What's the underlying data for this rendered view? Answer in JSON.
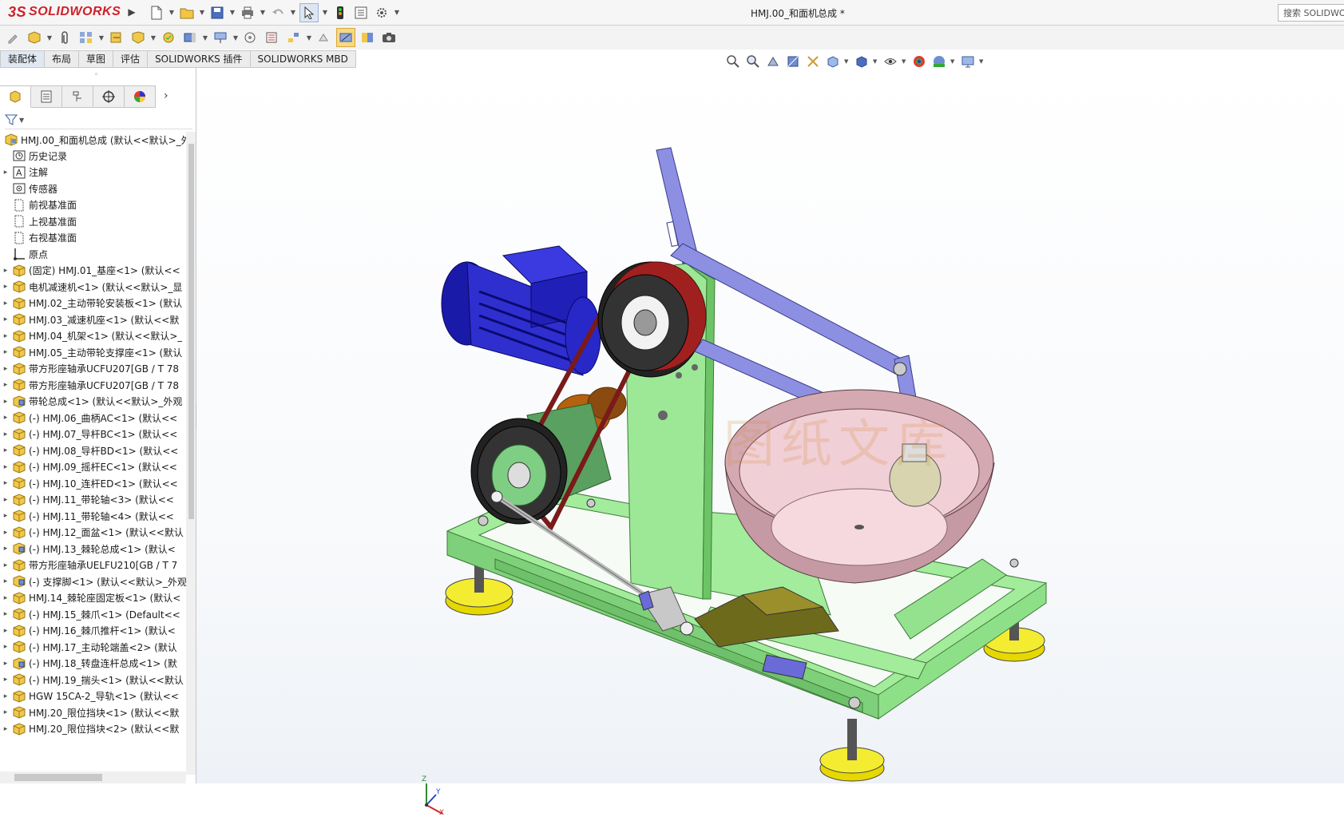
{
  "app": {
    "logo_text": "SOLIDWORKS",
    "logo_prefix": "3S",
    "document_title": "HMJ.00_和面机总成 *",
    "search_placeholder": "搜索 SOLIDWORKS"
  },
  "command_tabs": [
    {
      "label": "装配体",
      "active": true
    },
    {
      "label": "布局"
    },
    {
      "label": "草图"
    },
    {
      "label": "评估"
    },
    {
      "label": "SOLIDWORKS 插件"
    },
    {
      "label": "SOLIDWORKS MBD"
    }
  ],
  "feature_tree": {
    "root": "HMJ.00_和面机总成 (默认<<默认>_外",
    "items": [
      {
        "label": "历史记录",
        "icon": "history-icon",
        "expandable": false
      },
      {
        "label": "注解",
        "icon": "annotation-icon",
        "expandable": true
      },
      {
        "label": "传感器",
        "icon": "sensor-icon",
        "expandable": false
      },
      {
        "label": "前视基准面",
        "icon": "plane-icon",
        "expandable": false
      },
      {
        "label": "上视基准面",
        "icon": "plane-icon",
        "expandable": false
      },
      {
        "label": "右视基准面",
        "icon": "plane-icon",
        "expandable": false
      },
      {
        "label": "原点",
        "icon": "origin-icon",
        "expandable": false
      },
      {
        "label": "(固定) HMJ.01_基座<1> (默认<<",
        "icon": "part-icon",
        "expandable": true
      },
      {
        "label": "电机减速机<1> (默认<<默认>_显",
        "icon": "part-icon",
        "expandable": true
      },
      {
        "label": "HMJ.02_主动带轮安装板<1> (默认",
        "icon": "part-icon",
        "expandable": true
      },
      {
        "label": "HMJ.03_减速机座<1> (默认<<默",
        "icon": "part-icon",
        "expandable": true
      },
      {
        "label": "HMJ.04_机架<1> (默认<<默认>_",
        "icon": "part-icon",
        "expandable": true
      },
      {
        "label": "HMJ.05_主动带轮支撑座<1> (默认",
        "icon": "part-icon",
        "expandable": true
      },
      {
        "label": "带方形座轴承UCFU207[GB / T 78",
        "icon": "part-icon",
        "expandable": true
      },
      {
        "label": "带方形座轴承UCFU207[GB / T 78",
        "icon": "part-icon",
        "expandable": true
      },
      {
        "label": "带轮总成<1> (默认<<默认>_外观",
        "icon": "assembly-icon",
        "expandable": true
      },
      {
        "label": "(-) HMJ.06_曲柄AC<1> (默认<<",
        "icon": "part-icon",
        "expandable": true
      },
      {
        "label": "(-) HMJ.07_导杆BC<1> (默认<<",
        "icon": "part-icon",
        "expandable": true
      },
      {
        "label": "(-) HMJ.08_导杆BD<1> (默认<<",
        "icon": "part-icon",
        "expandable": true
      },
      {
        "label": "(-) HMJ.09_摇杆EC<1> (默认<<",
        "icon": "part-icon",
        "expandable": true
      },
      {
        "label": "(-) HMJ.10_连杆ED<1> (默认<<",
        "icon": "part-icon",
        "expandable": true
      },
      {
        "label": "(-) HMJ.11_带轮轴<3> (默认<<",
        "icon": "part-icon",
        "expandable": true
      },
      {
        "label": "(-) HMJ.11_带轮轴<4> (默认<<",
        "icon": "part-icon",
        "expandable": true
      },
      {
        "label": "(-) HMJ.12_面盆<1> (默认<<默认",
        "icon": "part-icon",
        "expandable": true
      },
      {
        "label": "(-) HMJ.13_棘轮总成<1> (默认<",
        "icon": "assembly-icon",
        "expandable": true
      },
      {
        "label": "带方形座轴承UELFU210[GB / T 7",
        "icon": "part-icon",
        "expandable": true
      },
      {
        "label": "(-) 支撑脚<1> (默认<<默认>_外观",
        "icon": "assembly-icon",
        "expandable": true
      },
      {
        "label": "HMJ.14_棘轮座固定板<1> (默认<",
        "icon": "part-icon",
        "expandable": true
      },
      {
        "label": "(-) HMJ.15_棘爪<1> (Default<<",
        "icon": "part-icon",
        "expandable": true
      },
      {
        "label": "(-) HMJ.16_棘爪推杆<1> (默认<",
        "icon": "part-icon",
        "expandable": true
      },
      {
        "label": "(-) HMJ.17_主动轮端盖<2> (默认",
        "icon": "part-icon",
        "expandable": true
      },
      {
        "label": "(-) HMJ.18_转盘连杆总成<1> (默",
        "icon": "assembly-icon",
        "expandable": true
      },
      {
        "label": "(-) HMJ.19_揣头<1> (默认<<默认",
        "icon": "part-icon",
        "expandable": true
      },
      {
        "label": "HGW 15CA-2_导轨<1> (默认<<",
        "icon": "part-icon",
        "expandable": true
      },
      {
        "label": "HMJ.20_限位挡块<1> (默认<<默",
        "icon": "part-icon",
        "expandable": true
      },
      {
        "label": "HMJ.20_限位挡块<2> (默认<<默",
        "icon": "part-icon",
        "expandable": true
      }
    ]
  },
  "viewport": {
    "watermark": "图纸文库",
    "triad": {
      "x": "X",
      "y": "Y",
      "z": "Z"
    }
  },
  "colors": {
    "brand": "#d0202a",
    "frame_green": "#8fe08a",
    "arm_purple": "#8b8ee0",
    "bowl_pink": "#e8b8c0",
    "motor_blue": "#2a2acb",
    "feet_yellow": "#f0e020"
  }
}
